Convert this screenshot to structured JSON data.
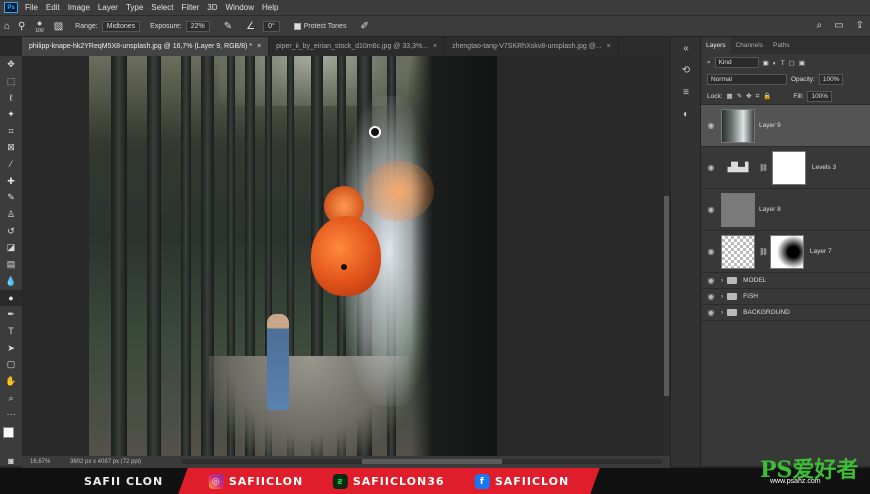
{
  "menu": [
    "File",
    "Edit",
    "Image",
    "Layer",
    "Type",
    "Select",
    "Filter",
    "3D",
    "Window",
    "Help"
  ],
  "app_logo": "Ps",
  "options": {
    "brush_size": "100",
    "range_label": "Range:",
    "range_value": "Midtones",
    "exposure_label": "Exposure:",
    "exposure_value": "22%",
    "angle_value": "0°",
    "protect_tones": "Protect Tones"
  },
  "tabs": [
    {
      "label": "philipp-knape-hk2YReqM5X8-unsplash.jpg @ 16,7% (Layer 9, RGB/8) *",
      "active": true
    },
    {
      "label": "piper_ii_by_eirian_stock_d10m6c.jpg @ 33,3%...",
      "active": false
    },
    {
      "label": "zhengtao-tang-V7SKRhXskv8-unsplash.jpg @...",
      "active": false
    }
  ],
  "tab_close": "×",
  "status": {
    "zoom": "16,67%",
    "dims": "3602 px x 4087 px (72 ppi)"
  },
  "layers_panel": {
    "tabs": [
      "Layers",
      "Channels",
      "Paths"
    ],
    "filter_kind": "Kind",
    "blend_mode": "Normal",
    "opacity_label": "Opacity:",
    "opacity_value": "100%",
    "lock_label": "Lock:",
    "fill_label": "Fill:",
    "fill_value": "100%",
    "layers": [
      {
        "name": "Layer 9"
      },
      {
        "name": "Levels 3"
      },
      {
        "name": "Layer 8"
      },
      {
        "name": "Layer 7"
      }
    ],
    "groups": [
      "MODEL",
      "FISH",
      "BACKGROUND"
    ]
  },
  "banner": {
    "name": "SAFII CLON",
    "instagram": "SAFIICLON",
    "deviantart": "SAFIICLON36",
    "facebook": "SAFIICLON"
  },
  "watermark": {
    "text": "PS爱好者",
    "url": "www.psahz.com"
  },
  "icons": [
    "home-icon",
    "dodge-tool-icon",
    "search-icon",
    "workspace-icon",
    "share-icon"
  ]
}
